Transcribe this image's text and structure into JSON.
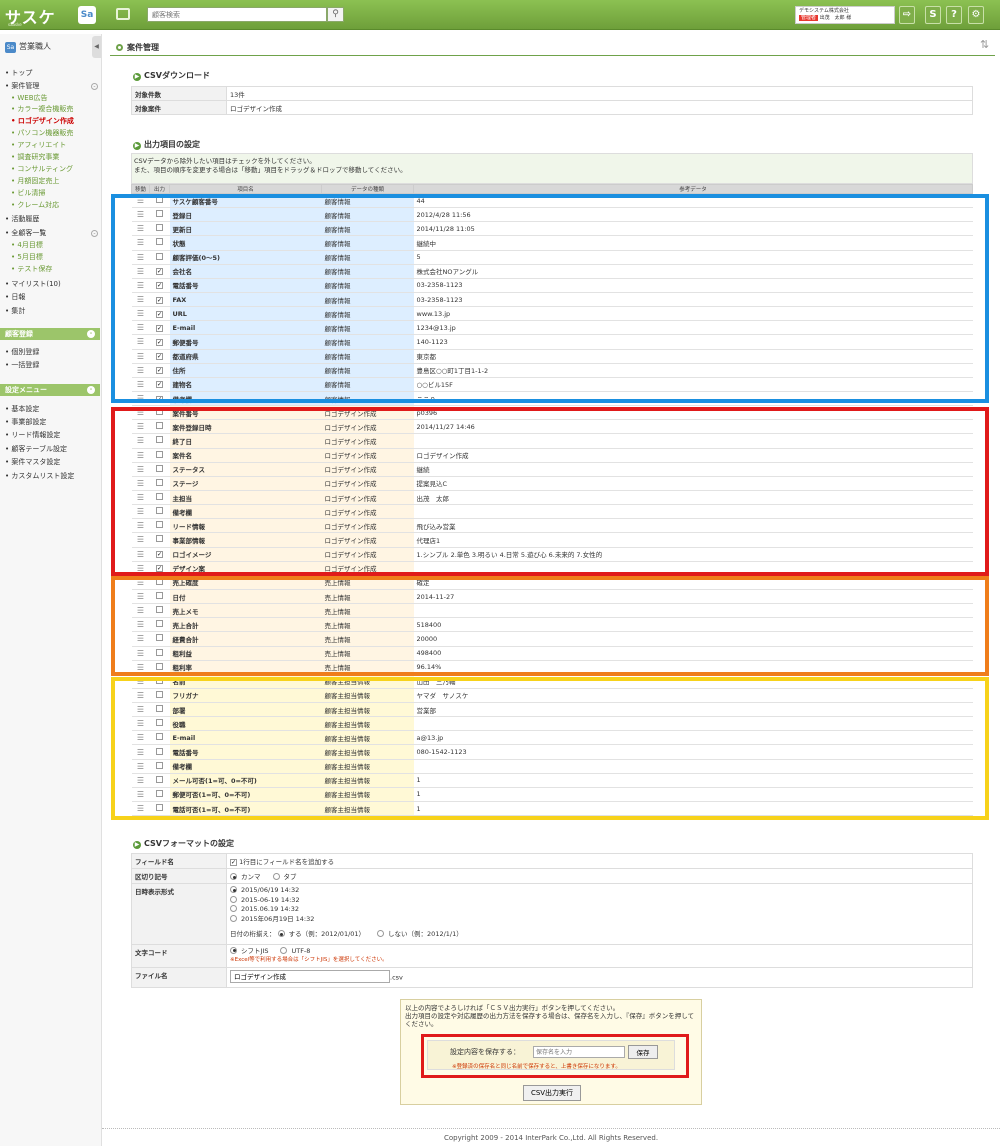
{
  "header": {
    "logo_text": "サスケ",
    "logo_tagline": "saaske",
    "app_badge": "Sa",
    "search_placeholder": "顧客検索",
    "company": "デモシステム株式会社",
    "user_role": "管理者",
    "user_name": "出茂　太郎 様",
    "icons": [
      "logout-icon",
      "saaske-icon",
      "help-icon",
      "settings-icon"
    ]
  },
  "sidebar": {
    "title": "営業職人",
    "items": [
      {
        "label": "トップ",
        "level": 0
      },
      {
        "label": "案件管理",
        "level": 0
      },
      {
        "label": "WEB広告",
        "level": 1
      },
      {
        "label": "カラー複合機販売",
        "level": 1
      },
      {
        "label": "ロゴデザイン作成",
        "level": 1,
        "active": true
      },
      {
        "label": "パソコン機器販売",
        "level": 1
      },
      {
        "label": "アフィリエイト",
        "level": 1
      },
      {
        "label": "調査研究事業",
        "level": 1
      },
      {
        "label": "コンサルティング",
        "level": 1
      },
      {
        "label": "月額固定売上",
        "level": 1
      },
      {
        "label": "ビル清掃",
        "level": 1
      },
      {
        "label": "クレーム対応",
        "level": 1
      },
      {
        "label": "活動履歴",
        "level": 0
      },
      {
        "label": "全顧客一覧",
        "level": 0
      },
      {
        "label": "4月目標",
        "level": 1
      },
      {
        "label": "5月目標",
        "level": 1
      },
      {
        "label": "テスト保存",
        "level": 1
      },
      {
        "label": "マイリスト(10)",
        "level": 0
      },
      {
        "label": "日報",
        "level": 0
      },
      {
        "label": "集計",
        "level": 0
      }
    ],
    "section_customer": "顧客登録",
    "customer_items": [
      "個別登録",
      "一括登録"
    ],
    "section_settings": "設定メニュー",
    "settings_items": [
      "基本設定",
      "事業部設定",
      "リード情報設定",
      "顧客テーブル設定",
      "案件マスタ設定",
      "カスタムリスト設定"
    ]
  },
  "main": {
    "title": "案件管理",
    "download": {
      "heading": "CSVダウンロード",
      "rows": [
        {
          "key": "対象件数",
          "value": "13件"
        },
        {
          "key": "対象案件",
          "value": "ロゴデザイン作成"
        }
      ]
    },
    "output": {
      "heading": "出力項目の設定",
      "desc1": "CSVデータから除外したい項目はチェックを外してください。",
      "desc2": "また、項目の順序を変更する場合は「移動」項目をドラッグ＆ドロップで移動してください。",
      "col_move": "移動",
      "col_out": "出力",
      "col_name": "項目名",
      "col_type": "データの種類",
      "col_ref": "参考データ",
      "rows": [
        {
          "g": "g1",
          "on": false,
          "name": "サスケ顧客番号",
          "type": "顧客情報",
          "ref": "44"
        },
        {
          "g": "g1",
          "on": false,
          "name": "登録日",
          "type": "顧客情報",
          "ref": "2012/4/28 11:56"
        },
        {
          "g": "g1",
          "on": false,
          "name": "更新日",
          "type": "顧客情報",
          "ref": "2014/11/28 11:05"
        },
        {
          "g": "g1",
          "on": false,
          "name": "状態",
          "type": "顧客情報",
          "ref": "継続中"
        },
        {
          "g": "g1",
          "on": false,
          "name": "顧客評価(0〜5)",
          "type": "顧客情報",
          "ref": "5"
        },
        {
          "g": "g1",
          "on": true,
          "name": "会社名",
          "type": "顧客情報",
          "ref": "株式会社NOアングル"
        },
        {
          "g": "g1",
          "on": true,
          "name": "電話番号",
          "type": "顧客情報",
          "ref": "03-2358-1123"
        },
        {
          "g": "g1",
          "on": true,
          "name": "FAX",
          "type": "顧客情報",
          "ref": "03-2358-1123"
        },
        {
          "g": "g1",
          "on": true,
          "name": "URL",
          "type": "顧客情報",
          "ref": "www.13.jp"
        },
        {
          "g": "g1",
          "on": true,
          "name": "E-mail",
          "type": "顧客情報",
          "ref": "1234@13.jp"
        },
        {
          "g": "g1",
          "on": true,
          "name": "郵便番号",
          "type": "顧客情報",
          "ref": "140-1123"
        },
        {
          "g": "g1",
          "on": true,
          "name": "都道府県",
          "type": "顧客情報",
          "ref": "東京都"
        },
        {
          "g": "g1",
          "on": true,
          "name": "住所",
          "type": "顧客情報",
          "ref": "豊島区○○町1丁目1-1-2"
        },
        {
          "g": "g1",
          "on": true,
          "name": "建物名",
          "type": "顧客情報",
          "ref": "○○ビル15F"
        },
        {
          "g": "g1",
          "on": true,
          "name": "備考欄",
          "type": "顧客情報",
          "ref": "ここ９"
        },
        {
          "g": "g2",
          "on": false,
          "name": "案件番号",
          "type": "ロゴデザイン作成",
          "ref": "p0396"
        },
        {
          "g": "g2",
          "on": false,
          "name": "案件登録日時",
          "type": "ロゴデザイン作成",
          "ref": "2014/11/27 14:46"
        },
        {
          "g": "g2",
          "on": false,
          "name": "終了日",
          "type": "ロゴデザイン作成",
          "ref": ""
        },
        {
          "g": "g2",
          "on": false,
          "name": "案件名",
          "type": "ロゴデザイン作成",
          "ref": "ロゴデザイン作成"
        },
        {
          "g": "g2",
          "on": false,
          "name": "ステータス",
          "type": "ロゴデザイン作成",
          "ref": "継続"
        },
        {
          "g": "g2",
          "on": false,
          "name": "ステージ",
          "type": "ロゴデザイン作成",
          "ref": "提案見込C"
        },
        {
          "g": "g2",
          "on": false,
          "name": "主担当",
          "type": "ロゴデザイン作成",
          "ref": "出茂　太郎"
        },
        {
          "g": "g2",
          "on": false,
          "name": "備考欄",
          "type": "ロゴデザイン作成",
          "ref": ""
        },
        {
          "g": "g2",
          "on": false,
          "name": "リード情報",
          "type": "ロゴデザイン作成",
          "ref": "飛び込み営業"
        },
        {
          "g": "g2",
          "on": false,
          "name": "事業部情報",
          "type": "ロゴデザイン作成",
          "ref": "代理店1"
        },
        {
          "g": "g2",
          "on": true,
          "name": "ロゴイメージ",
          "type": "ロゴデザイン作成",
          "ref": "1.シンプル 2.単色 3.明るい 4.日常 5.遊び心 6.未来的 7.女性的"
        },
        {
          "g": "g2",
          "on": true,
          "name": "デザイン案",
          "type": "ロゴデザイン作成",
          "ref": ""
        },
        {
          "g": "g3",
          "on": false,
          "name": "売上確度",
          "type": "売上情報",
          "ref": "確定"
        },
        {
          "g": "g3",
          "on": false,
          "name": "日付",
          "type": "売上情報",
          "ref": "2014-11-27"
        },
        {
          "g": "g3",
          "on": false,
          "name": "売上メモ",
          "type": "売上情報",
          "ref": ""
        },
        {
          "g": "g3",
          "on": false,
          "name": "売上合計",
          "type": "売上情報",
          "ref": "518400"
        },
        {
          "g": "g3",
          "on": false,
          "name": "経費合計",
          "type": "売上情報",
          "ref": "20000"
        },
        {
          "g": "g3",
          "on": false,
          "name": "粗利益",
          "type": "売上情報",
          "ref": "498400"
        },
        {
          "g": "g3",
          "on": false,
          "name": "粗利率",
          "type": "売上情報",
          "ref": "96.14%"
        },
        {
          "g": "g4",
          "on": false,
          "name": "名前",
          "type": "顧客主担当情報",
          "ref": "山田　三乃輔"
        },
        {
          "g": "g4",
          "on": false,
          "name": "フリガナ",
          "type": "顧客主担当情報",
          "ref": "ヤマダ　サノスケ"
        },
        {
          "g": "g4",
          "on": false,
          "name": "部署",
          "type": "顧客主担当情報",
          "ref": "営業部"
        },
        {
          "g": "g4",
          "on": false,
          "name": "役職",
          "type": "顧客主担当情報",
          "ref": ""
        },
        {
          "g": "g4",
          "on": false,
          "name": "E-mail",
          "type": "顧客主担当情報",
          "ref": "a@13.jp"
        },
        {
          "g": "g4",
          "on": false,
          "name": "電話番号",
          "type": "顧客主担当情報",
          "ref": "080-1542-1123"
        },
        {
          "g": "g4",
          "on": false,
          "name": "備考欄",
          "type": "顧客主担当情報",
          "ref": ""
        },
        {
          "g": "g4",
          "on": false,
          "name": "メール可否(1=可、0=不可)",
          "type": "顧客主担当情報",
          "ref": "1"
        },
        {
          "g": "g4",
          "on": false,
          "name": "郵便可否(1=可、0=不可)",
          "type": "顧客主担当情報",
          "ref": "1"
        },
        {
          "g": "g4",
          "on": false,
          "name": "電話可否(1=可、0=不可)",
          "type": "顧客主担当情報",
          "ref": "1"
        }
      ]
    },
    "format": {
      "heading": "CSVフォーマットの設定",
      "field_name_label": "フィールド名",
      "field_name_option": "1行目にフィールド名を追加する",
      "delimiter_label": "区切り記号",
      "delimiter_comma": "カンマ",
      "delimiter_tab": "タブ",
      "date_label": "日時表示形式",
      "date_options": [
        "2015/06/19 14:32",
        "2015-06-19 14:32",
        "2015.06.19 14:32",
        "2015年06月19日 14:32"
      ],
      "digits_label": "日付の桁揃え：",
      "digits_yes": "する（例：2012/01/01）",
      "digits_no": "しない（例：2012/1/1）",
      "encoding_label": "文字コード",
      "encoding_sjis": "シフトJIS",
      "encoding_utf8": "UTF-8",
      "encoding_note": "※Excel等で利用する場合は「シフトJIS」を選択してください。",
      "filename_label": "ファイル名",
      "filename_value": "ロゴデザイン作成",
      "filename_ext": ".csv"
    },
    "action": {
      "text1": "以上の内容でよろしければ「ＣＳＶ出力実行」ボタンを押してください。",
      "text2": "出力項目の設定や対応履歴の出力方法を保存する場合は、保存名を入力し、『保存』ボタンを押してください。",
      "save_label": "設定内容を保存する：",
      "save_placeholder": "保存名を入力",
      "save_button": "保存",
      "save_note": "※登録済の保存名と同じ名前で保存すると、上書き保存になります。",
      "csv_button": "CSV出力実行"
    }
  },
  "highlight_colors": {
    "blue": "#1a8fe0",
    "red": "#e01a1a",
    "orange": "#ef7d1a",
    "yellow": "#f7d21a"
  },
  "footer": "Copyright 2009 - 2014 InterPark Co.,Ltd. All Rights Reserved."
}
